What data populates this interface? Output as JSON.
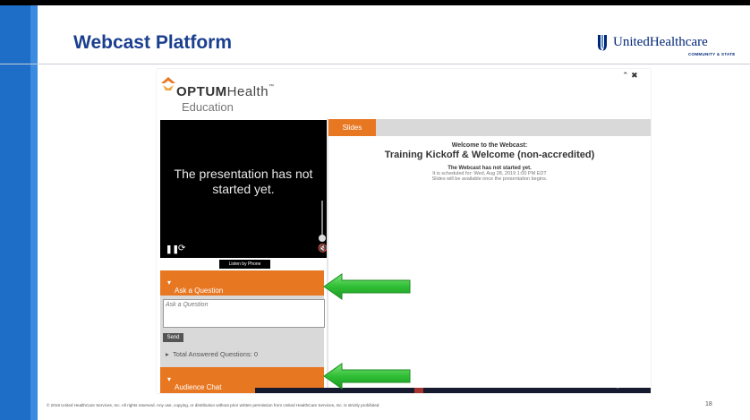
{
  "slide": {
    "title": "Webcast Platform",
    "page_number": "18",
    "footer": "© 2019 United HealthCare Services, Inc. All rights reserved. Any use, copying, or distribution without prior written permission from United HealthCare Services, Inc. is strictly prohibited."
  },
  "logo": {
    "name": "UnitedHealthcare",
    "subtitle": "COMMUNITY & STATE",
    "color": "#002677"
  },
  "colors": {
    "accent_orange": "#e87722",
    "title_blue": "#1b3f8f",
    "side_bar_blue": "#1e6ec8",
    "arrow_green": "#33c43a"
  },
  "webcast": {
    "brand": {
      "word_bold": "OPTUM",
      "word_regular": "Health",
      "tm": "™",
      "sub": "Education"
    },
    "player": {
      "message": "The presentation has not started yet.",
      "icons": [
        "pause-icon",
        "refresh-icon",
        "mute-icon",
        "volume-slider"
      ]
    },
    "listen_by_phone": "Listen by Phone",
    "ask": {
      "header": "Ask a Question",
      "placeholder": "Ask a Question",
      "send": "Send",
      "answered": "Total Answered Questions: 0"
    },
    "chat": {
      "header": "Audience Chat"
    },
    "tabs": [
      {
        "label": "Slides"
      }
    ],
    "welcome": {
      "line1": "Welcome to the Webcast:",
      "title": "Training Kickoff & Welcome (non-accredited)",
      "status": "The Webcast has not started yet.",
      "schedule": "It is scheduled for: Wed, Aug 28, 2019 1:00 PM EDT",
      "note": "Slides will be available once the presentation begins."
    }
  }
}
